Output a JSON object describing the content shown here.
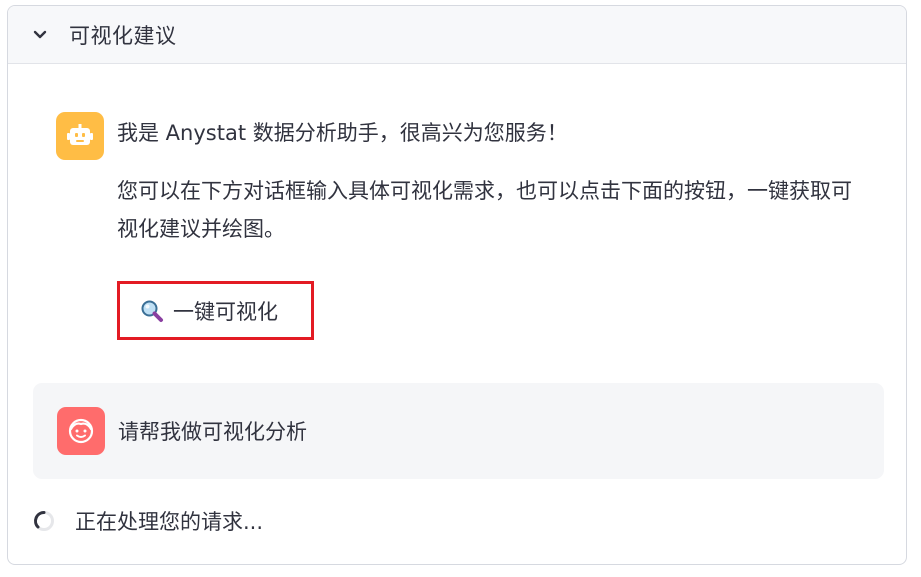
{
  "expander": {
    "title": "可视化建议"
  },
  "assistant_message": {
    "avatar_icon": "robot-icon",
    "avatar_color": "#ffbd45",
    "greeting": "我是 Anystat 数据分析助手，很高兴为您服务！",
    "instructions": "您可以在下方对话框输入具体可视化需求，也可以点击下面的按钮，一键获取可视化建议并绘图。",
    "button_label": "一键可视化",
    "button_icon": "magnifying-glass-icon",
    "button_highlight_color": "#e31b23"
  },
  "user_message": {
    "avatar_icon": "user-face-icon",
    "avatar_color": "#ff6c6c",
    "text": "请帮我做可视化分析"
  },
  "status": {
    "icon": "loading-spinner-icon",
    "text": "正在处理您的请求..."
  }
}
